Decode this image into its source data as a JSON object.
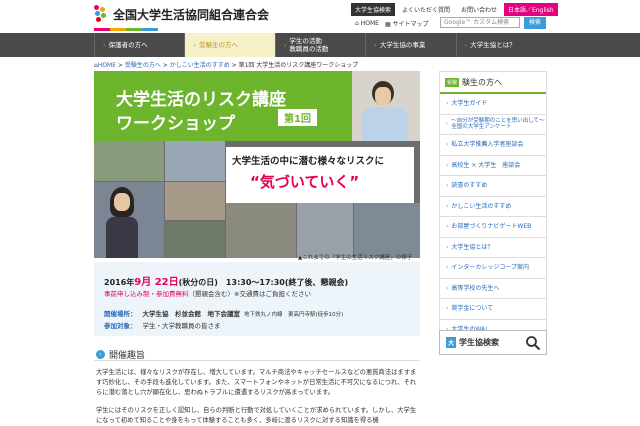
{
  "header": {
    "logo_text": "全国大学生活協同組合連合会",
    "top_links": [
      "大学生協検索",
      "よくいただく質問",
      "お問い合わせ",
      "日本語／English"
    ],
    "home": "HOME",
    "sitemap": "サイトマップ",
    "search_placeholder": "Google™ カスタム検索",
    "search_button": "検索"
  },
  "nav": {
    "items": [
      "保護者の方へ",
      "受験生の方へ",
      "学生の活動\n教職員の活動",
      "大学生協の事業",
      "大学生協とは？"
    ],
    "active_index": 1
  },
  "breadcrumb": {
    "home": "HOME",
    "sep": " > ",
    "items": [
      "受験生の方へ",
      "かしこい生活のすすめ",
      "第1回 大学生活のリスク講座ワークショップ"
    ]
  },
  "banner": {
    "title_line1": "大学生活のリスク講座",
    "title_line2": "ワークショップ",
    "badge": "第1回",
    "sub1": "大学生活の中に潜む様々なリスクに",
    "sub2": "“気づいていく”",
    "caption": "▲これまでの「学生の生活リスク講座」の様子"
  },
  "info": {
    "date_prefix": "2016年",
    "date_hl": "9月 22日",
    "date_suffix": "(秋分の日)　13:30～17:30(終了後、懇親会)",
    "apply": "事前申し込み制・参加費無料",
    "apply_note": "（懇親会含む）※交通費はご負担ください",
    "venue_label": "開催場所：",
    "venue": "大学生協　杉並会館　地下会議室",
    "venue_note": "地下鉄丸ノ内線　東高円寺駅(徒歩10分)",
    "target_label": "参加対象：",
    "target": "学生・大学教職員の皆さま"
  },
  "section": {
    "title": "開催趣旨",
    "para1": "大学生活には、様々なリスクが存在し、増大しています。マルチ商法やキャッチセールスなどの悪質商法はますます巧妙化し、その手段も進化しています。また、スマートフォンやネットが日常生活に不可欠になるにつれ、それらに潜む落とし穴が顕在化し、思わぬトラブルに遭遇するリスクが高まっています。",
    "para2": "学生にはそのリスクを正しく認知し、自らの判断と行動で対処していくことが求められています。しかし、大学生になって初めて知ることや身をもって体験することも多く、多岐に渡るリスクに対する知識を得る機"
  },
  "sidebar": {
    "head_icon": "受験",
    "head_title": "験生の方へ",
    "items": [
      "大学生ガイド",
      "〜自分が受験期のことを思い出して〜\n全国の大学生アンケート",
      "私立大学推薦入学者座談会",
      "高校生 × 大学生　座談会",
      "読書のすすめ",
      "かしこい生活のすすめ",
      "お部屋づくりナビゲートWEB",
      "大学生協とは？",
      "インターカレッジコープ案内",
      "高等学校の先生へ",
      "奨学金について",
      "大学生のWA!"
    ],
    "search_icon": "大",
    "search_label": "学生協検索"
  },
  "colors": {
    "accent_green": "#6cb52d",
    "accent_pink": "#e4005a",
    "link_blue": "#2a6ab8",
    "nav_bg": "#4a4a4a"
  }
}
